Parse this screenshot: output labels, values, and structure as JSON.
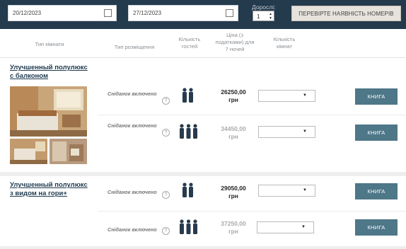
{
  "search": {
    "checkin": "20/12/2023",
    "checkout": "27/12/2023",
    "adults_label": "Дорослі:",
    "adults_value": "1",
    "check_button": "ПЕРЕВІРТЕ НАЯВНІСТЬ НОМЕРІВ"
  },
  "table": {
    "headers": {
      "room_type": "Тип кімнати",
      "board": "Тип розміщення",
      "guests": "Кількість гостей",
      "price": "Ціна (з податками) для 7 ночей",
      "rooms": "Кількість кімнат"
    }
  },
  "rooms": [
    {
      "title": "Улучшенный полулюкс с балконом",
      "rates": [
        {
          "meal": "Сніданок включено",
          "guests": 2,
          "price": "26250,00",
          "currency": "грн",
          "book": "КНИГА"
        },
        {
          "meal": "Сніданок включено",
          "guests": 3,
          "price": "34450,00",
          "currency": "грн",
          "book": "КНИГА"
        }
      ]
    },
    {
      "title": "Улучшенный полулюкс з видом на гори+",
      "rates": [
        {
          "meal": "Сніданок включено",
          "guests": 2,
          "price": "29050,00",
          "currency": "грн",
          "book": "КНИГА"
        },
        {
          "meal": "Сніданок включено",
          "guests": 3,
          "price": "37250,00",
          "currency": "грн",
          "book": "КНИГА"
        }
      ]
    }
  ],
  "icons": {
    "calendar": "calendar-icon",
    "guest": "person-icon",
    "help": "question-icon",
    "dropdown": "caret-down-icon"
  },
  "colors": {
    "topbar": "#243a4d",
    "book_button": "#4e7788",
    "title": "#1e3a4e"
  }
}
